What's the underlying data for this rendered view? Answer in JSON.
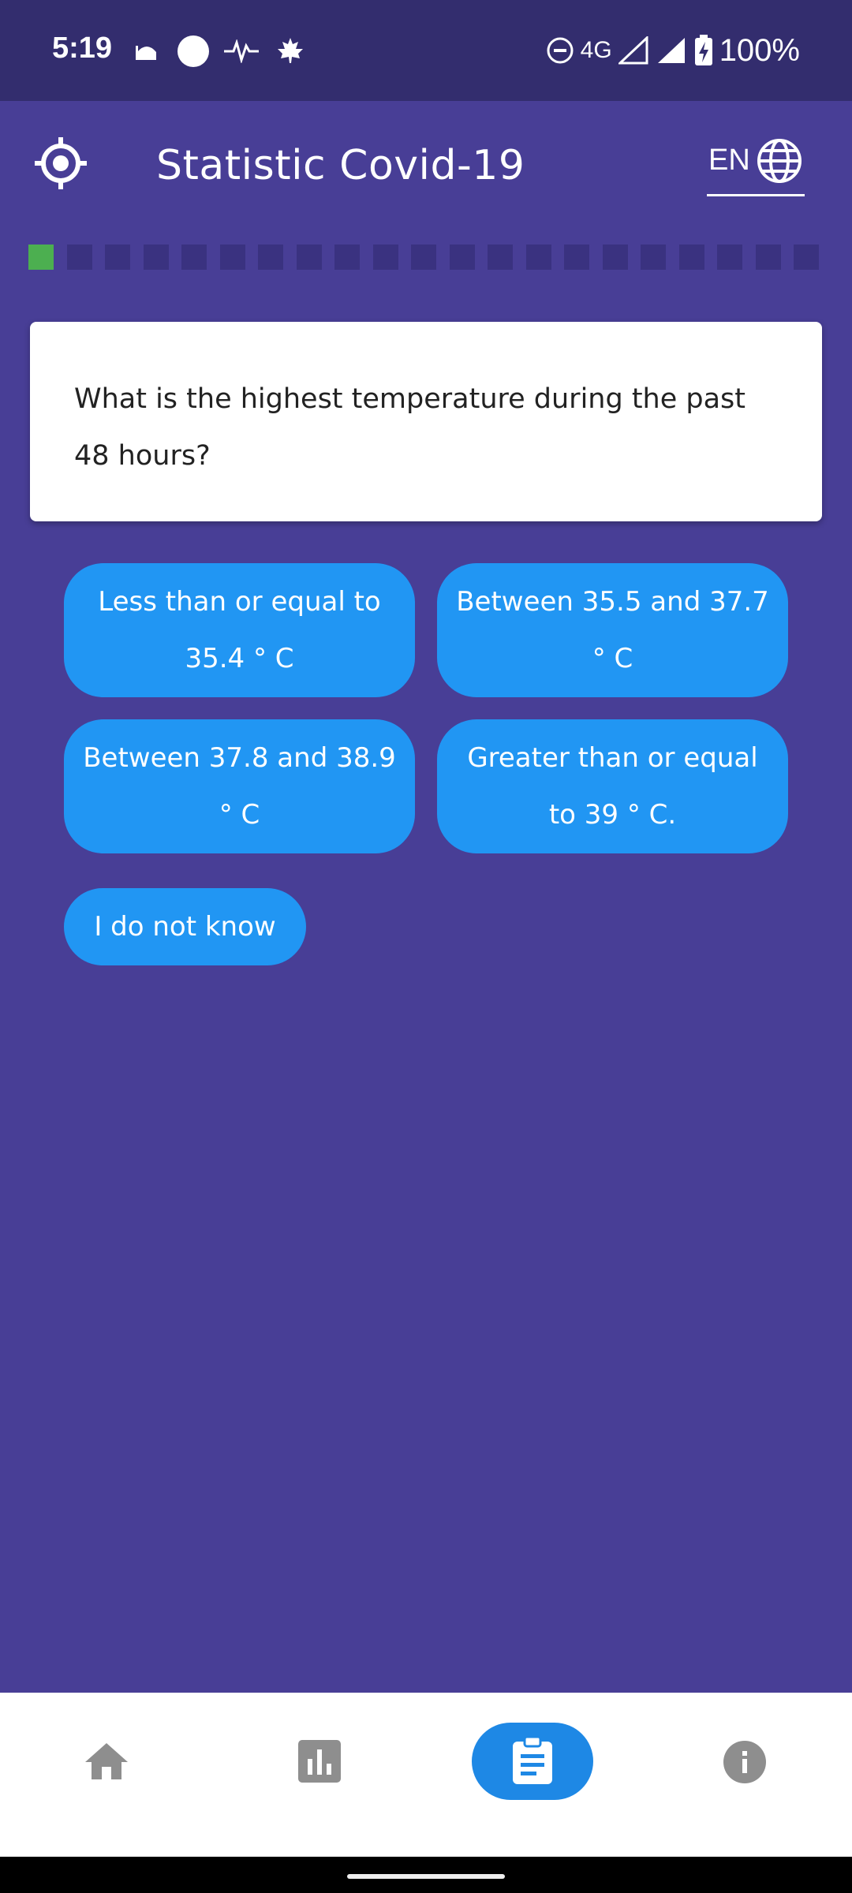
{
  "status_bar": {
    "time": "5:19",
    "network": "4G",
    "battery": "100%",
    "icons": [
      "mosque-notification-icon",
      "circle-notification-icon",
      "pulse-notification-icon",
      "maple-leaf-notification-icon",
      "do-not-disturb-icon",
      "signal-icon",
      "battery-charging-icon"
    ]
  },
  "app_bar": {
    "title": "Statistic Covid-19",
    "language": "EN",
    "left_icon": "crosshair-locate-icon",
    "right_icon": "globe-icon"
  },
  "progress": {
    "total_steps": 21,
    "current_step": 1,
    "done_color": "#4caf50",
    "pending_color": "#3a3280"
  },
  "question": {
    "text": "What is the highest temperature during the past 48 hours?"
  },
  "options": [
    {
      "label": "Less than or equal to 35.4 ° C"
    },
    {
      "label": "Between 35.5 and 37.7 ° C"
    },
    {
      "label": "Between 37.8 and 38.9 ° C"
    },
    {
      "label": "Greater than or equal to 39 ° C."
    },
    {
      "label": "I do not know"
    }
  ],
  "bottom_nav": {
    "items": [
      "home-icon",
      "bar-chart-icon",
      "clipboard-icon",
      "info-icon"
    ],
    "active": "clipboard-icon"
  },
  "colors": {
    "background": "#483e96",
    "status_bar": "#332d6e",
    "button": "#2196f3",
    "active_nav": "#1e88e5"
  }
}
